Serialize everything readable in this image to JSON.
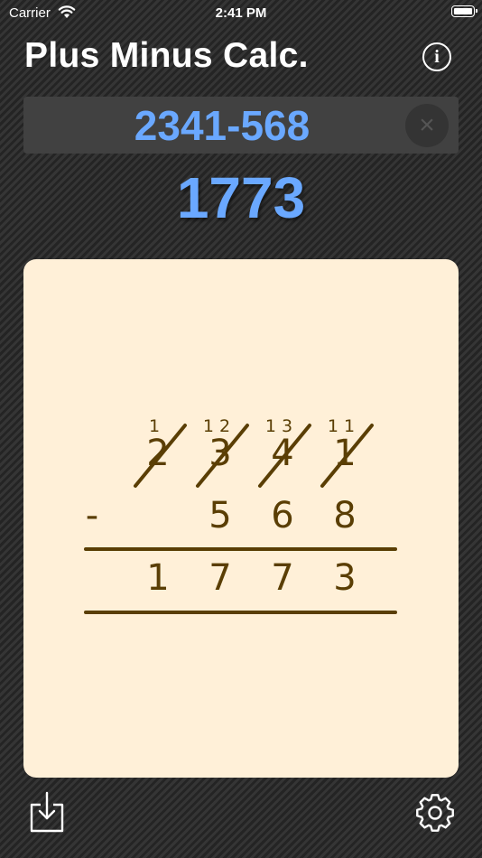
{
  "status": {
    "carrier": "Carrier",
    "time": "2:41 PM"
  },
  "header": {
    "title": "Plus Minus Calc.",
    "info_icon": "i"
  },
  "input": {
    "expression": "2341-568",
    "clear_icon": "×"
  },
  "result": {
    "value": "1773"
  },
  "worksheet": {
    "operator": "-",
    "top_digits": [
      "2",
      "3",
      "4",
      "1"
    ],
    "top_crossed": [
      true,
      true,
      true,
      true
    ],
    "borrow_marks": [
      "1",
      "1 2",
      "1 3",
      "1 1"
    ],
    "bottom_digits": [
      "",
      "5",
      "6",
      "8"
    ],
    "result_digits": [
      "1",
      "7",
      "7",
      "3"
    ],
    "ink_color": "#5a3e04"
  },
  "toolbar": {
    "share_icon": "share-icon",
    "settings_icon": "gear-icon"
  }
}
